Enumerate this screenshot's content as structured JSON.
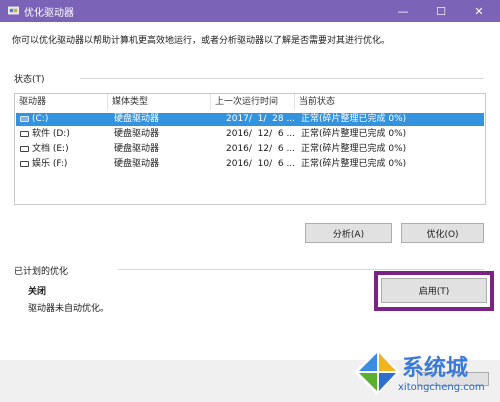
{
  "window": {
    "title": "优化驱动器",
    "controls": {
      "minimize": "—",
      "maximize": "☐",
      "close": "✕"
    }
  },
  "intro_text": "你可以优化驱动器以帮助计算机更高效地运行，或者分析驱动器以了解是否需要对其进行优化。",
  "status": {
    "label": "状态(T)",
    "columns": [
      "驱动器",
      "媒体类型",
      "上一次运行时间",
      "当前状态"
    ],
    "rows": [
      {
        "drive": "(C:)",
        "media": "硬盘驱动器",
        "last_run": "2017/  1/  28 ...",
        "status": "正常(碎片整理已完成 0%)",
        "selected": true
      },
      {
        "drive": "软件 (D:)",
        "media": "硬盘驱动器",
        "last_run": "2016/  12/  6 ...",
        "status": "正常(碎片整理已完成 0%)",
        "selected": false
      },
      {
        "drive": "文档 (E:)",
        "media": "硬盘驱动器",
        "last_run": "2016/  12/  6 ...",
        "status": "正常(碎片整理已完成 0%)",
        "selected": false
      },
      {
        "drive": "娱乐 (F:)",
        "media": "硬盘驱动器",
        "last_run": "2016/  10/  6 ...",
        "status": "正常(碎片整理已完成 0%)",
        "selected": false
      }
    ]
  },
  "buttons": {
    "analyze": "分析(A)",
    "optimize": "优化(O)",
    "enable": "启用(T)"
  },
  "scheduled": {
    "label": "已计划的优化",
    "state": "关闭",
    "description": "驱动器未自动优化。"
  },
  "watermark": {
    "text": "系统城",
    "url": "xitongcheng.com"
  },
  "colors": {
    "titlebar": "#7b64b8",
    "selection": "#3393df",
    "highlight_border": "#7b2383",
    "watermark": "#3a7ad9"
  }
}
